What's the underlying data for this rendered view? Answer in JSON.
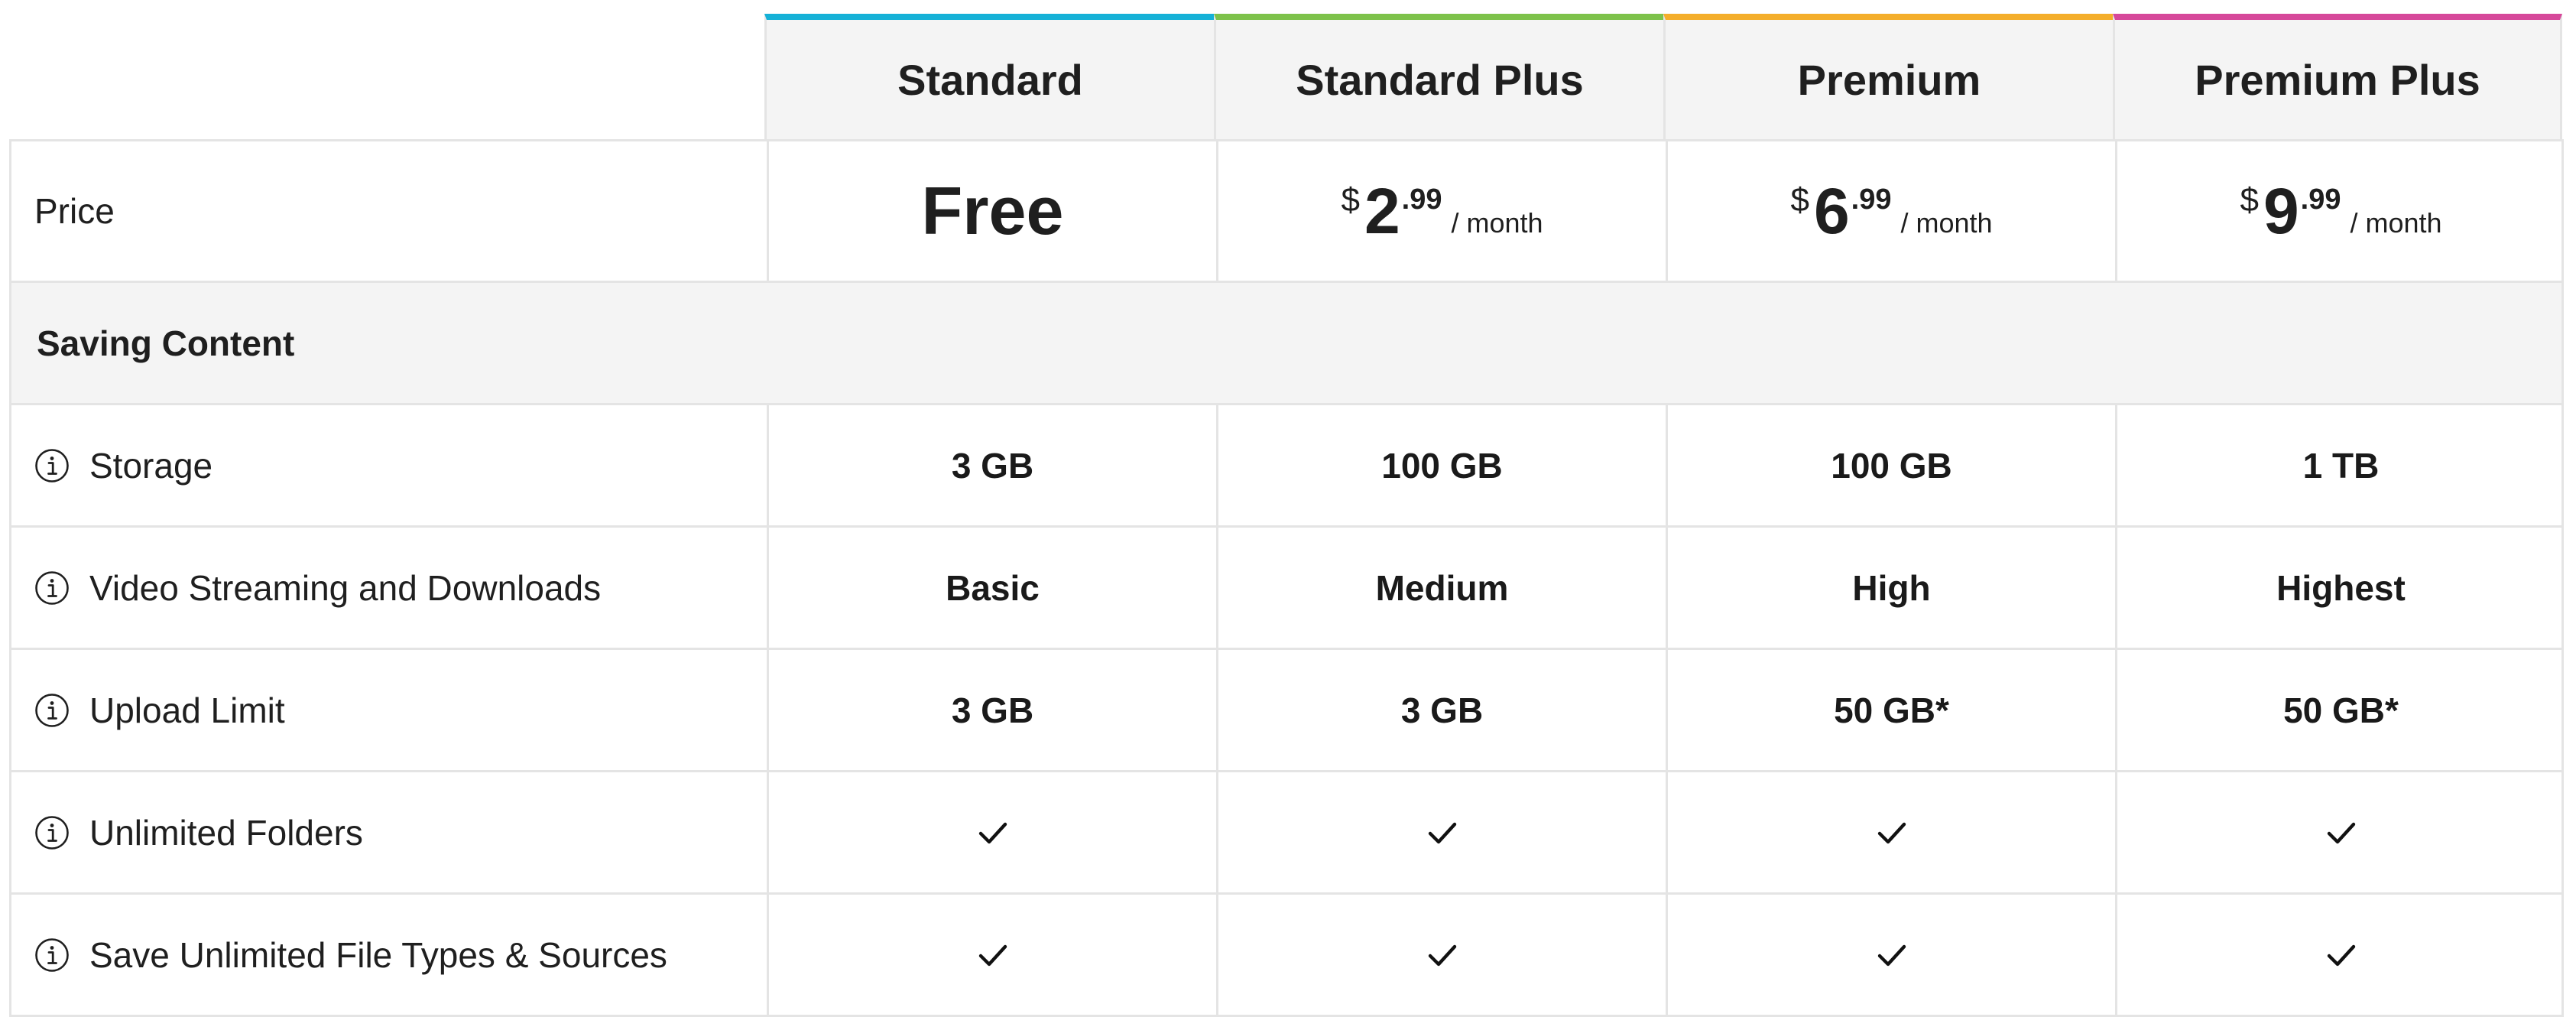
{
  "plans": [
    {
      "name": "Standard",
      "accent": "#15b1d7"
    },
    {
      "name": "Standard Plus",
      "accent": "#7dc24b"
    },
    {
      "name": "Premium",
      "accent": "#f4ae2b"
    },
    {
      "name": "Premium Plus",
      "accent": "#d6489a"
    }
  ],
  "price_row": {
    "label": "Price",
    "free_label": "Free",
    "currency": "$",
    "per_label": "/ month",
    "prices": [
      {
        "whole": "2",
        "cents": ".99"
      },
      {
        "whole": "6",
        "cents": ".99"
      },
      {
        "whole": "9",
        "cents": ".99"
      }
    ]
  },
  "section": {
    "title": "Saving Content"
  },
  "features": [
    {
      "label": "Storage",
      "values": [
        "3 GB",
        "100 GB",
        "100 GB",
        "1 TB"
      ]
    },
    {
      "label": "Video Streaming and Downloads",
      "values": [
        "Basic",
        "Medium",
        "High",
        "Highest"
      ]
    },
    {
      "label": "Upload Limit",
      "values": [
        "3 GB",
        "3 GB",
        "50 GB*",
        "50 GB*"
      ]
    },
    {
      "label": "Unlimited Folders",
      "values": [
        "check",
        "check",
        "check",
        "check"
      ]
    },
    {
      "label": "Save Unlimited File Types & Sources",
      "values": [
        "check",
        "check",
        "check",
        "check"
      ]
    }
  ],
  "icons": {
    "feature_info": "info-circle-icon",
    "included": "checkmark-icon"
  },
  "colors": {
    "header_bg": "#f4f4f4",
    "border": "#e4e4e4",
    "text": "#1f1f1f"
  }
}
